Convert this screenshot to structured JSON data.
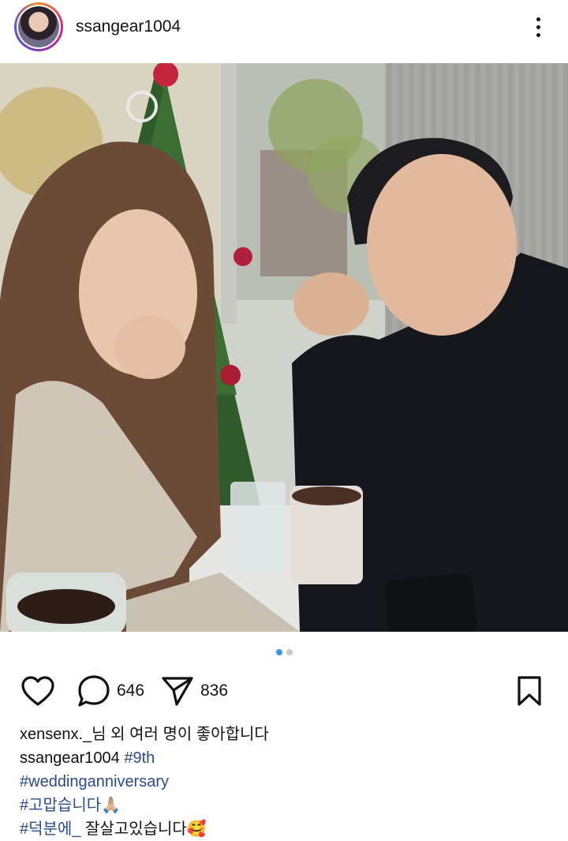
{
  "header": {
    "username": "ssangear1004",
    "avatar_icon": "profile-avatar",
    "more_icon": "more-vertical-icon"
  },
  "carousel": {
    "total_slides": 2,
    "active_slide": 1,
    "active_color": "#3897f0",
    "inactive_color": "#c8c8c8"
  },
  "actions": {
    "like_icon": "heart-icon",
    "comment_icon": "comment-icon",
    "comment_count": "646",
    "share_icon": "send-icon",
    "share_count": "836",
    "save_icon": "bookmark-icon"
  },
  "likes": {
    "text": "xensenx._님 외 여러 명이 좋아합니다"
  },
  "caption": {
    "username": "ssangear1004",
    "tag1": "#9th",
    "tag2": "#weddinganniversary",
    "tag3": "#고맙습니다",
    "emoji3": "🙏🏼",
    "tag4": "#덕분에_",
    "text4": " 잘살고있습니다",
    "emoji4": "🥰"
  },
  "colors": {
    "hashtag": "#2b4a8a",
    "text": "#111111"
  }
}
